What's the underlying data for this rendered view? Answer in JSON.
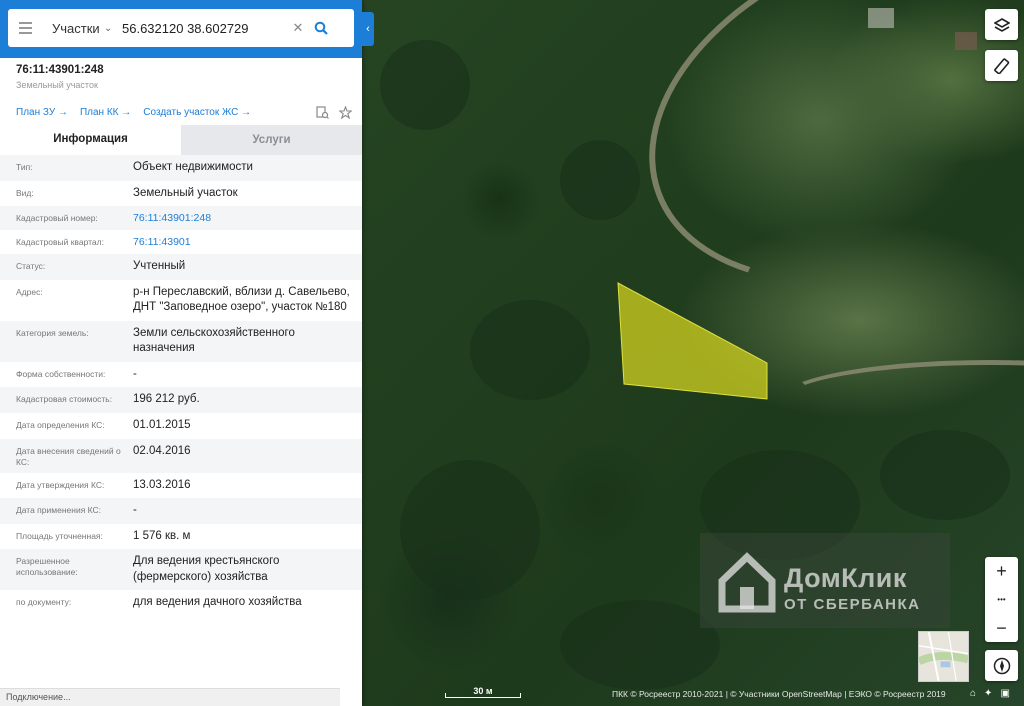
{
  "search": {
    "type_label": "Участки",
    "query": "56.632120 38.602729"
  },
  "object": {
    "cadastral_number": "76:11:43901:248",
    "subtitle": "Земельный участок"
  },
  "links": {
    "plan_zu": "План ЗУ →",
    "plan_kk": "План КК →",
    "create_zs": "Создать участок ЖС →"
  },
  "tabs": {
    "info": "Информация",
    "services": "Услуги"
  },
  "rows": [
    {
      "key": "Тип:",
      "value": "Объект недвижимости"
    },
    {
      "key": "Вид:",
      "value": "Земельный участок"
    },
    {
      "key": "Кадастровый номер:",
      "value": "76:11:43901:248"
    },
    {
      "key": "Кадастровый квартал:",
      "value": "76:11:43901"
    },
    {
      "key": "Статус:",
      "value": "Учтенный"
    },
    {
      "key": "Адрес:",
      "value": "р-н Переславский, вблизи д. Савельево, ДНТ \"Заповедное озеро\", участок №180"
    },
    {
      "key": "Категория земель:",
      "value": "Земли сельскохозяйственного назначения"
    },
    {
      "key": "Форма собственности:",
      "value": "-"
    },
    {
      "key": "Кадастровая стоимость:",
      "value": "196 212 руб."
    },
    {
      "key": "Дата определения КС:",
      "value": "01.01.2015"
    },
    {
      "key": "Дата внесения сведений о КС:",
      "value": "02.04.2016"
    },
    {
      "key": "Дата утверждения КС:",
      "value": "13.03.2016"
    },
    {
      "key": "Дата применения КС:",
      "value": "-"
    },
    {
      "key": "Площадь уточненная:",
      "value": "1 576 кв. м"
    },
    {
      "key": "Разрешенное использование:",
      "value": "Для ведения крестьянского (фермерского) хозяйства"
    },
    {
      "key": "по документу:",
      "value": "для ведения дачного хозяйства"
    }
  ],
  "status_text": "Подключение...",
  "map": {
    "scale_label": "30 м",
    "attribution": "ПКК © Росреестр 2010-2021 | © Участники OpenStreetMap | ЕЭКО © Росреестр 2019",
    "watermark_title": "ДомКлик",
    "watermark_sub": "ОТ СБЕРБАНКА",
    "zoom_in": "+",
    "zoom_more": "•••",
    "zoom_out": "−",
    "parcel_color": "#d8d820",
    "accent_color": "#1c7ed6"
  }
}
